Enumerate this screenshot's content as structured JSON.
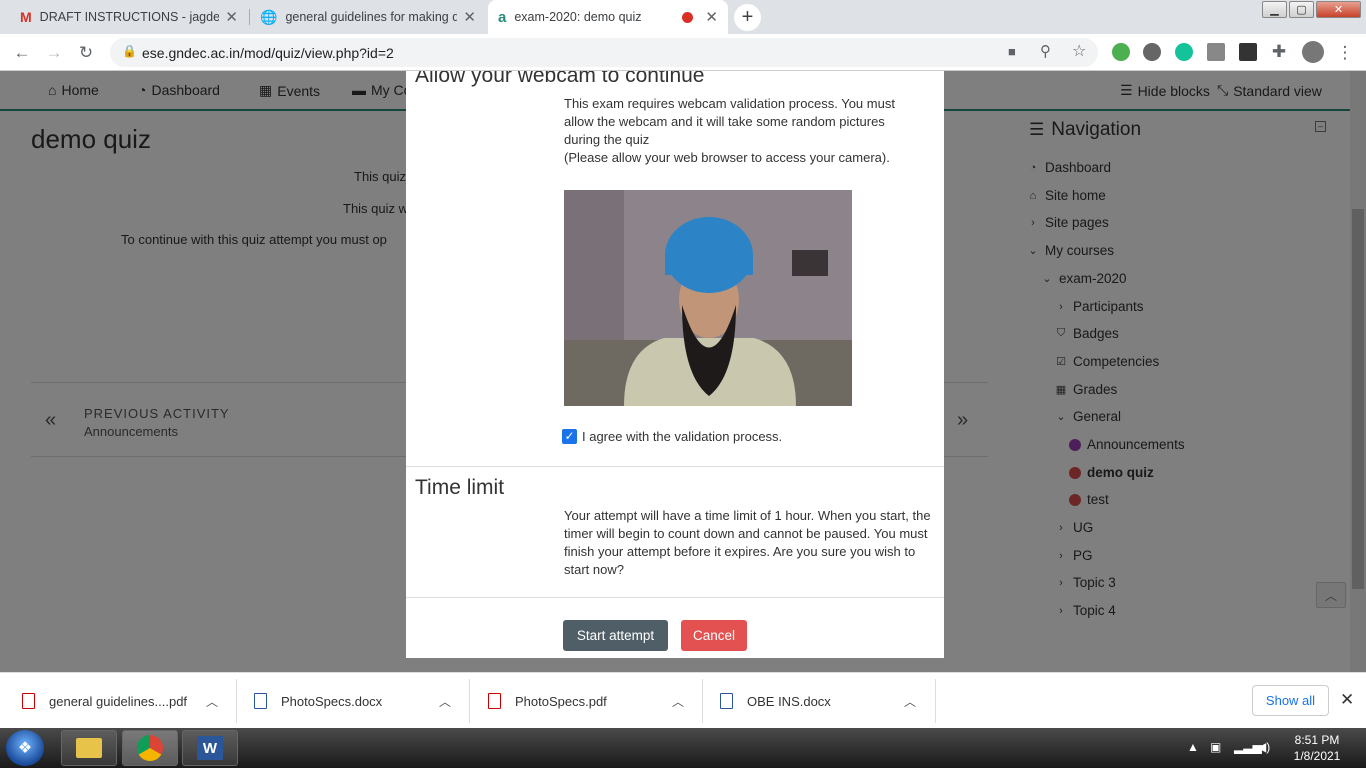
{
  "tabs": [
    {
      "title": "DRAFT INSTRUCTIONS - jagdeep",
      "icon": "gmail-icon"
    },
    {
      "title": "general guidelines for making qu",
      "icon": "globe-icon"
    },
    {
      "title": "exam-2020: demo quiz",
      "icon": "moodle-icon",
      "active": true
    }
  ],
  "toolbar": {
    "url": "ese.gndec.ac.in/mod/quiz/view.php?id=2"
  },
  "navbar": {
    "home": "Home",
    "dashboard": "Dashboard",
    "events": "Events",
    "mycourses": "My Co",
    "hideblocks": "Hide blocks",
    "standardview": "Standard view"
  },
  "page": {
    "title": "demo quiz",
    "line1": "This quiz",
    "line2": "This quiz w",
    "line3": "To continue with this quiz attempt you must op",
    "prev_label": "PREVIOUS ACTIVITY",
    "prev_value": "Announcements"
  },
  "navigation": {
    "heading": "Navigation",
    "items": [
      {
        "label": "Dashboard"
      },
      {
        "label": "Site home"
      },
      {
        "label": "Site pages"
      },
      {
        "label": "My courses"
      },
      {
        "label": "exam-2020"
      },
      {
        "label": "Participants"
      },
      {
        "label": "Badges"
      },
      {
        "label": "Competencies"
      },
      {
        "label": "Grades"
      },
      {
        "label": "General"
      },
      {
        "label": "Announcements"
      },
      {
        "label": "demo quiz"
      },
      {
        "label": "test"
      },
      {
        "label": "UG"
      },
      {
        "label": "PG"
      },
      {
        "label": "Topic 3"
      },
      {
        "label": "Topic 4"
      }
    ]
  },
  "modal": {
    "webcam_heading": "Allow your webcam to continue",
    "webcam_text": "This exam requires webcam validation process. You must allow the webcam and it will take some random pictures during the quiz",
    "webcam_note": "(Please allow your web browser to access your camera).",
    "agree_label": "I agree with the validation process.",
    "agree_checked": true,
    "time_heading": "Time limit",
    "time_text": "Your attempt will have a time limit of 1 hour. When you start, the timer will begin to count down and cannot be paused. You must finish your attempt before it expires. Are you sure you wish to start now?",
    "start_label": "Start attempt",
    "cancel_label": "Cancel"
  },
  "downloads": [
    {
      "name": "general guidelines....pdf",
      "type": "pdf"
    },
    {
      "name": "PhotoSpecs.docx",
      "type": "docx"
    },
    {
      "name": "PhotoSpecs.pdf",
      "type": "pdf"
    },
    {
      "name": "OBE INS.docx",
      "type": "docx"
    }
  ],
  "downloads_bar": {
    "show_all": "Show all"
  },
  "taskbar": {
    "time": "8:51 PM",
    "date": "1/8/2021"
  },
  "colors": {
    "start_button": "#4f5e67",
    "cancel_button": "#e35150",
    "accent": "#2b8a7d"
  }
}
